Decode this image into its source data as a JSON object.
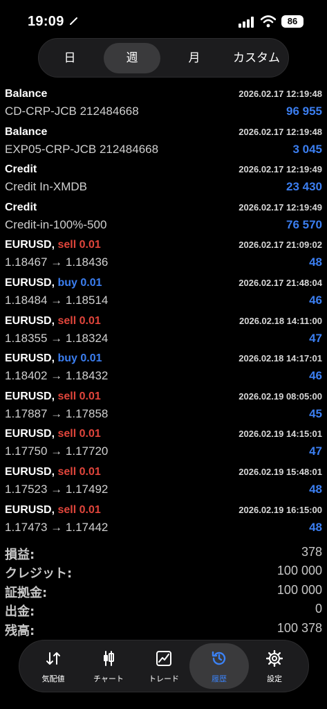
{
  "status": {
    "time": "19:09",
    "battery": "86"
  },
  "periods": [
    "日",
    "週",
    "月",
    "カスタム"
  ],
  "active_period": "週",
  "rows": [
    {
      "title": "Balance",
      "action": "",
      "action_type": "",
      "date": "2026.02.17 12:19:48",
      "desc": "CD-CRP-JCB 212484668",
      "amount": "96 955"
    },
    {
      "title": "Balance",
      "action": "",
      "action_type": "",
      "date": "2026.02.17 12:19:48",
      "desc": "EXP05-CRP-JCB 212484668",
      "amount": "3 045"
    },
    {
      "title": "Credit",
      "action": "",
      "action_type": "",
      "date": "2026.02.17 12:19:49",
      "desc": "Credit In-XMDB",
      "amount": "23 430"
    },
    {
      "title": "Credit",
      "action": "",
      "action_type": "",
      "date": "2026.02.17 12:19:49",
      "desc": "Credit-in-100%-500",
      "amount": "76 570"
    },
    {
      "title": "EURUSD,",
      "action": "sell 0.01",
      "action_type": "sell",
      "date": "2026.02.17 21:09:02",
      "desc": "1.18467 → 1.18436",
      "amount": "48"
    },
    {
      "title": "EURUSD,",
      "action": "buy 0.01",
      "action_type": "buy",
      "date": "2026.02.17 21:48:04",
      "desc": "1.18484 → 1.18514",
      "amount": "46"
    },
    {
      "title": "EURUSD,",
      "action": "sell 0.01",
      "action_type": "sell",
      "date": "2026.02.18 14:11:00",
      "desc": "1.18355 → 1.18324",
      "amount": "47"
    },
    {
      "title": "EURUSD,",
      "action": "buy 0.01",
      "action_type": "buy",
      "date": "2026.02.18 14:17:01",
      "desc": "1.18402 → 1.18432",
      "amount": "46"
    },
    {
      "title": "EURUSD,",
      "action": "sell 0.01",
      "action_type": "sell",
      "date": "2026.02.19 08:05:00",
      "desc": "1.17887 → 1.17858",
      "amount": "45"
    },
    {
      "title": "EURUSD,",
      "action": "sell 0.01",
      "action_type": "sell",
      "date": "2026.02.19 14:15:01",
      "desc": "1.17750 → 1.17720",
      "amount": "47"
    },
    {
      "title": "EURUSD,",
      "action": "sell 0.01",
      "action_type": "sell",
      "date": "2026.02.19 15:48:01",
      "desc": "1.17523 → 1.17492",
      "amount": "48"
    },
    {
      "title": "EURUSD,",
      "action": "sell 0.01",
      "action_type": "sell",
      "date": "2026.02.19 16:15:00",
      "desc": "1.17473 → 1.17442",
      "amount": "48"
    }
  ],
  "summary": [
    {
      "label": "損益:",
      "value": "378"
    },
    {
      "label": "クレジット:",
      "value": "100 000"
    },
    {
      "label": "証拠金:",
      "value": "100 000"
    },
    {
      "label": "出金:",
      "value": "0"
    },
    {
      "label": "残高:",
      "value": "100 378"
    }
  ],
  "tabs": [
    {
      "label": "気配値",
      "icon": "quotes-icon",
      "active": false
    },
    {
      "label": "チャート",
      "icon": "chart-icon",
      "active": false
    },
    {
      "label": "トレード",
      "icon": "trade-icon",
      "active": false
    },
    {
      "label": "履歴",
      "icon": "history-icon",
      "active": true
    },
    {
      "label": "設定",
      "icon": "settings-icon",
      "active": false
    }
  ],
  "colors": {
    "sell": "#e0453b",
    "buy": "#3b7ef0",
    "amount": "#3b7ef0",
    "active_tab": "#3b82f6"
  }
}
